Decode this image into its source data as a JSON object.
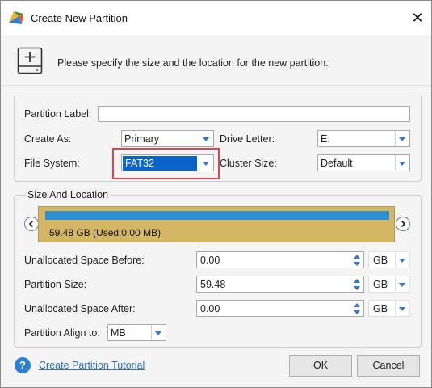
{
  "window": {
    "title": "Create New Partition",
    "close_glyph": "✕"
  },
  "header": {
    "icon": "add-disk-icon",
    "instruction": "Please specify the size and the location for the new partition."
  },
  "form": {
    "partition_label": {
      "label": "Partition Label:",
      "value": ""
    },
    "create_as": {
      "label": "Create As:",
      "value": "Primary"
    },
    "drive_letter": {
      "label": "Drive Letter:",
      "value": "E:"
    },
    "file_system": {
      "label": "File System:",
      "value": "FAT32"
    },
    "cluster_size": {
      "label": "Cluster Size:",
      "value": "Default"
    }
  },
  "size_location": {
    "title": "Size And Location",
    "disk_bar_text": "59.48 GB (Used:0.00 MB)",
    "used_fraction": 0.0,
    "unallocated_before": {
      "label": "Unallocated Space Before:",
      "value": "0.00",
      "unit": "GB"
    },
    "partition_size": {
      "label": "Partition Size:",
      "value": "59.48",
      "unit": "GB"
    },
    "unallocated_after": {
      "label": "Unallocated Space After:",
      "value": "0.00",
      "unit": "GB"
    },
    "align": {
      "label": "Partition Align to:",
      "value": "MB"
    }
  },
  "footer": {
    "help_glyph": "?",
    "tutorial_link": "Create Partition Tutorial",
    "ok_label": "OK",
    "cancel_label": "Cancel"
  },
  "colors": {
    "highlight_border": "#e0434d",
    "disk_bar": "#d4b765",
    "partition_bar": "#2f8fd4",
    "selection": "#0a64c8",
    "link": "#2d6fc2"
  }
}
